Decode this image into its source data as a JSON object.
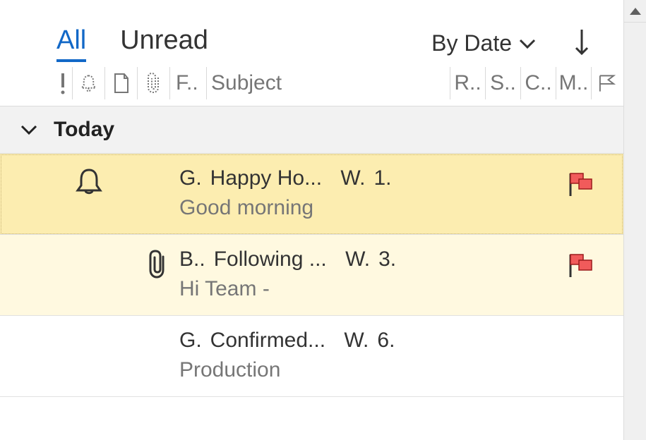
{
  "tabs": {
    "all": "All",
    "unread": "Unread"
  },
  "sort": {
    "label": "By Date"
  },
  "columns": {
    "from": "F..",
    "subject": "Subject",
    "r": "R..",
    "s": "S..",
    "c": "C..",
    "m": "M.."
  },
  "group": {
    "label": "Today"
  },
  "messages": [
    {
      "reminder": true,
      "attachment": false,
      "flagged": true,
      "selected": true,
      "from": "G.",
      "subject": "Happy Ho...",
      "received": "W.",
      "size": "1.",
      "preview": "Good morning"
    },
    {
      "reminder": false,
      "attachment": true,
      "flagged": true,
      "selected": false,
      "from": "B..",
      "subject": "Following ...",
      "received": "W.",
      "size": "3.",
      "preview": "Hi Team -"
    },
    {
      "reminder": false,
      "attachment": false,
      "flagged": false,
      "selected": false,
      "from": "G.",
      "subject": "Confirmed...",
      "received": "W.",
      "size": "6.",
      "preview": "Production"
    }
  ],
  "colors": {
    "accent": "#1268c7",
    "flag_fill": "#f15b5b",
    "flag_stroke": "#9b1c1c",
    "row_selected": "#fcedb0",
    "row_flagged": "#fff9e0"
  }
}
